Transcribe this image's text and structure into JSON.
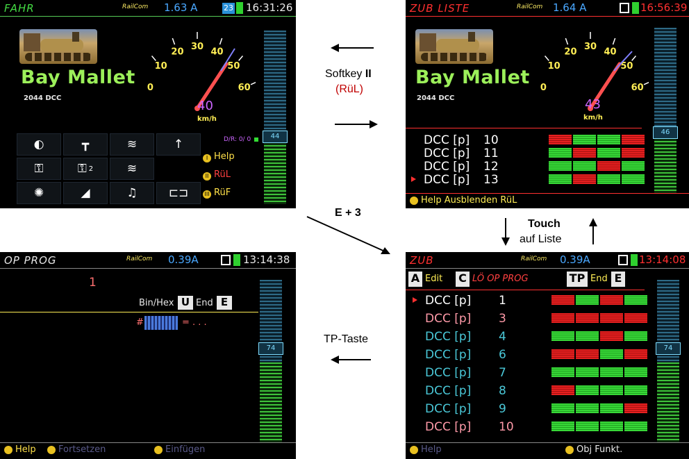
{
  "screen1": {
    "title": "FAHR",
    "logo": "RailCom",
    "current": "1.63 A",
    "battery_label": "23",
    "time": "16:31:26",
    "loco_name": "Bay Mallet",
    "loco_addr": "2044  DCC",
    "dial_ticks": [
      "0",
      "10",
      "20",
      "30",
      "40",
      "50",
      "60"
    ],
    "speed": "40",
    "unit": "km/h",
    "slider_value": "44",
    "dir_text": "D/R: 0/ 0",
    "functions": [
      "light-icon",
      "coupler-icon",
      "horn-icon",
      "direction-up-icon",
      "smoke-icon",
      "smoke2-icon",
      "bell-icon",
      "flash-icon",
      "radio-icon",
      "music-icon",
      "shunt-icon"
    ],
    "func_sub": "2",
    "softkeys": [
      {
        "num": "I",
        "label": "Help",
        "color": "#ffe14a"
      },
      {
        "num": "II",
        "label": "RüL",
        "color": "#ff4040"
      },
      {
        "num": "III",
        "label": "RüF",
        "color": "#ffe14a"
      }
    ]
  },
  "screen2": {
    "title": "ZUB LISTE",
    "logo": "RailCom",
    "current": "1.64 A",
    "time": "16:56:39",
    "loco_name": "Bay Mallet",
    "loco_addr": "2044  DCC",
    "dial_ticks": [
      "0",
      "10",
      "20",
      "30",
      "40",
      "50",
      "60"
    ],
    "speed": "43",
    "unit": "km/h",
    "slider_value": "46",
    "rows": [
      {
        "proto": "DCC [p]",
        "num": "10",
        "blocks": [
          "r",
          "g",
          "g",
          "r"
        ]
      },
      {
        "proto": "DCC [p]",
        "num": "11",
        "blocks": [
          "g",
          "r",
          "g",
          "r"
        ]
      },
      {
        "proto": "DCC [p]",
        "num": "12",
        "blocks": [
          "g",
          "g",
          "r",
          "g"
        ]
      },
      {
        "proto": "DCC [p]",
        "num": "13",
        "blocks": [
          "g",
          "r",
          "g",
          "g"
        ]
      }
    ],
    "footer": "Help  Ausblenden RüL"
  },
  "screen3": {
    "title": "OP PROG",
    "logo": "RailCom",
    "current": "0.39A",
    "time": "13:14:38",
    "value": "1",
    "binhex": "Bin/Hex",
    "key_u": "U",
    "end_label": "End",
    "key_e": "E",
    "hash": "#",
    "equals": "= . . .",
    "slider_value": "74",
    "footer": [
      "Help",
      "Fortsetzen",
      "Einfügen"
    ]
  },
  "screen4": {
    "title": "ZUB",
    "logo": "RailCom",
    "current": "0.39A",
    "time": "13:14:08",
    "tabs": {
      "a": "A",
      "edit": "Edit",
      "c": "C",
      "lo": "LÖ OP PROG",
      "tp": "TP",
      "end": "End",
      "e": "E"
    },
    "rows": [
      {
        "proto": "DCC [p]",
        "num": "1",
        "color": "#ffffff",
        "blocks": [
          "r",
          "g",
          "r",
          "g"
        ]
      },
      {
        "proto": "DCC [p]",
        "num": "3",
        "color": "#ff9aa8",
        "blocks": [
          "r",
          "r",
          "r",
          "r"
        ]
      },
      {
        "proto": "DCC [p]",
        "num": "4",
        "color": "#4ac8d8",
        "blocks": [
          "g",
          "g",
          "r",
          "g"
        ]
      },
      {
        "proto": "DCC [p]",
        "num": "6",
        "color": "#4ac8d8",
        "blocks": [
          "r",
          "r",
          "g",
          "r"
        ]
      },
      {
        "proto": "DCC [p]",
        "num": "7",
        "color": "#4ac8d8",
        "blocks": [
          "g",
          "g",
          "g",
          "g"
        ]
      },
      {
        "proto": "DCC [p]",
        "num": "8",
        "color": "#4ac8d8",
        "blocks": [
          "r",
          "g",
          "g",
          "g"
        ]
      },
      {
        "proto": "DCC [p]",
        "num": "9",
        "color": "#4ac8d8",
        "blocks": [
          "g",
          "g",
          "g",
          "r"
        ]
      },
      {
        "proto": "DCC [p]",
        "num": "10",
        "color": "#ff9aa8",
        "blocks": [
          "g",
          "g",
          "g",
          "g"
        ]
      }
    ],
    "slider_value": "74",
    "footer_left": "Help",
    "footer_right": "Obj Funkt."
  },
  "annotations": {
    "softkey": "Softkey ",
    "softkey_bold": "II",
    "rul": "(RüL)",
    "e3": "E + 3",
    "touch": "Touch",
    "auf_liste": "auf Liste",
    "tp_taste": "TP-Taste"
  }
}
